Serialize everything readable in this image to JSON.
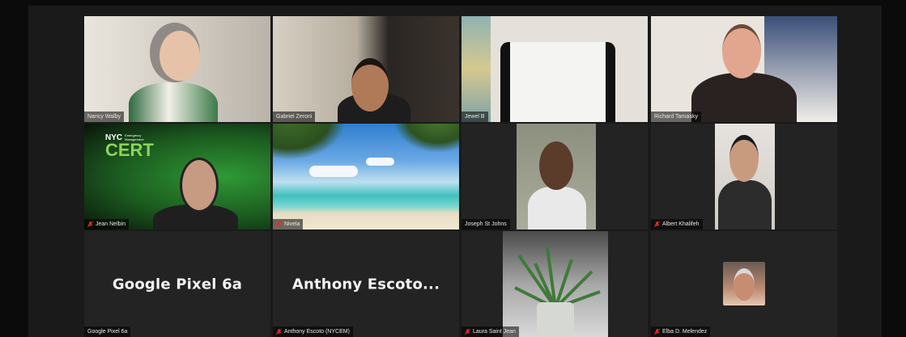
{
  "meeting": {
    "participants": [
      {
        "name": "Nancy Walby",
        "muted": false,
        "video": true,
        "speaking": true
      },
      {
        "name": "Gabriel Zeroni",
        "muted": false,
        "video": true
      },
      {
        "name": "Jewel B",
        "muted": false,
        "video": true
      },
      {
        "name": "Richard Tarnasky",
        "muted": false,
        "video": true
      },
      {
        "name": "Jean Nelbin",
        "muted": true,
        "video": true,
        "background": {
          "logo_line1": "NYC",
          "logo_line2": "CERT",
          "logo_sub1": "Emergency",
          "logo_sub2": "Management"
        }
      },
      {
        "name": "Nivela",
        "muted": true,
        "video": true
      },
      {
        "name": "Joseph St Johns",
        "muted": false,
        "video": true
      },
      {
        "name": "Albert Khalifeh",
        "muted": true,
        "video": true
      },
      {
        "name": "Google Pixel 6a",
        "muted": false,
        "video": false,
        "display_name": "Google Pixel 6a"
      },
      {
        "name": "Anthony Escoto (NYCEM)",
        "muted": true,
        "video": false,
        "display_name": "Anthony  Escoto..."
      },
      {
        "name": "Laura Saint Jean",
        "muted": true,
        "video": true
      },
      {
        "name": "Elba D. Melendez",
        "muted": true,
        "video": false
      }
    ]
  },
  "colors": {
    "mute": "#e0312b",
    "speaking": "#f1d94b",
    "green_screen": "#2b8a2f"
  }
}
